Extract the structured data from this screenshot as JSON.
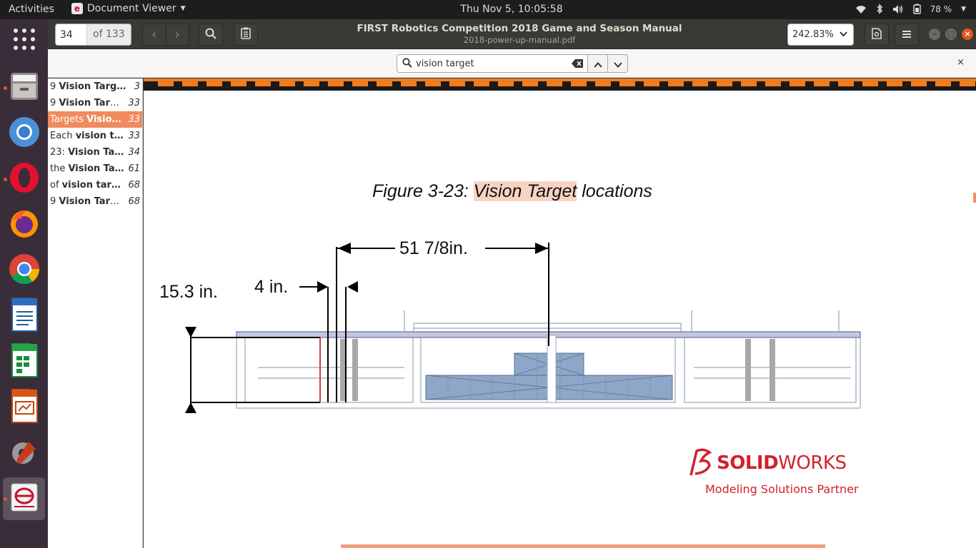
{
  "topbar": {
    "activities": "Activities",
    "app_name": "Document Viewer",
    "clock": "Thu Nov  5, 10:05:58",
    "battery": "78 %"
  },
  "dock": {
    "items": [
      "Files",
      "Chromium",
      "Opera",
      "Firefox",
      "Google Chrome",
      "LibreOffice Writer",
      "LibreOffice Calc",
      "LibreOffice Impress",
      "Settings",
      "Document Viewer"
    ]
  },
  "header": {
    "page_value": "34",
    "page_of": "of 133",
    "title": "FIRST Robotics Competition 2018 Game and Season Manual",
    "filename": "2018-power-up-manual.pdf",
    "zoom": "242.83%"
  },
  "search": {
    "query": "vision target"
  },
  "results": [
    {
      "pre": "9 ",
      "bold": "Vision Targ…",
      "post": "",
      "page": "3"
    },
    {
      "pre": "9 ",
      "bold": "Vision Targ…",
      "post": "",
      "page": "33"
    },
    {
      "pre": "Targets ",
      "bold": "Visio…",
      "post": "",
      "page": "33"
    },
    {
      "pre": "Each ",
      "bold": "vision t…",
      "post": "",
      "page": "33"
    },
    {
      "pre": "23: ",
      "bold": "Vision Ta…",
      "post": "",
      "page": "34"
    },
    {
      "pre": "the ",
      "bold": "Vision Ta…",
      "post": "",
      "page": "61"
    },
    {
      "pre": "of ",
      "bold": "vision tar…",
      "post": "",
      "page": "68"
    },
    {
      "pre": "9 ",
      "bold": "Vision Targ…",
      "post": "",
      "page": "68"
    }
  ],
  "document": {
    "caption_prefix": "Figure 3-23: ",
    "caption_highlight": "Vision Target",
    "caption_suffix": " locations",
    "dim_width": "51 7/8in.",
    "dim_gap": "4 in.",
    "dim_height": "15.3 in.",
    "logo_brand_a": "SOLID",
    "logo_brand_b": "WORKS",
    "logo_partner": "Modeling Solutions Partner"
  },
  "colors": {
    "accent": "#e95420",
    "highlight": "#f9d3c2",
    "selected_result": "#f08b5e"
  }
}
